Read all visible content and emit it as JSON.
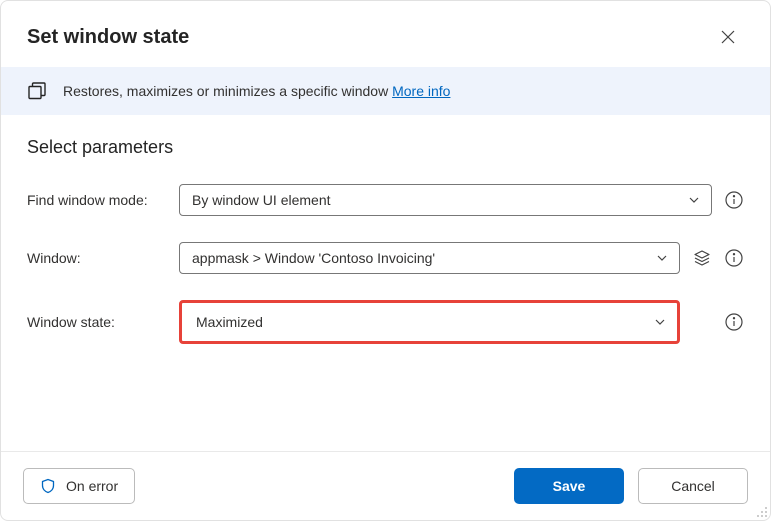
{
  "header": {
    "title": "Set window state"
  },
  "banner": {
    "text": "Restores, maximizes or minimizes a specific window ",
    "link": "More info"
  },
  "section": {
    "title": "Select parameters"
  },
  "fields": {
    "findWindowMode": {
      "label": "Find window mode:",
      "value": "By window UI element"
    },
    "window": {
      "label": "Window:",
      "value": "appmask > Window 'Contoso Invoicing'"
    },
    "windowState": {
      "label": "Window state:",
      "value": "Maximized"
    }
  },
  "footer": {
    "onError": "On error",
    "save": "Save",
    "cancel": "Cancel"
  }
}
